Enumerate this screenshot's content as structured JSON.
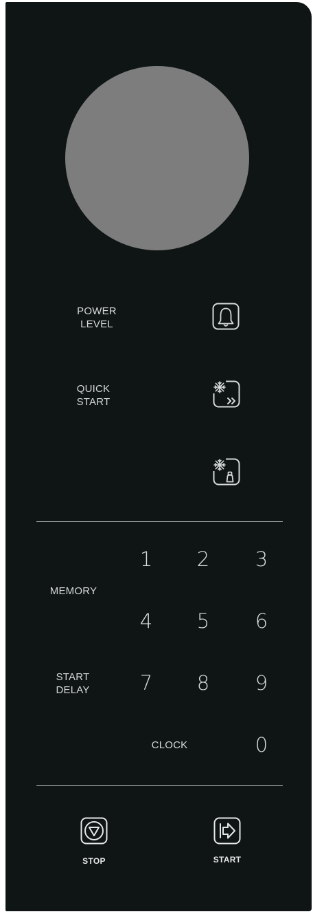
{
  "panel": {
    "power_level_label": "POWER\nLEVEL",
    "quick_start_label": "QUICK\nSTART",
    "memory_label": "MEMORY",
    "start_delay_label": "START\nDELAY",
    "clock_label": "CLOCK",
    "stop_label": "STOP",
    "start_label": "START"
  },
  "keypad": {
    "digits": [
      "1",
      "2",
      "3",
      "4",
      "5",
      "6",
      "7",
      "8",
      "9",
      "0"
    ]
  },
  "icons": {
    "timer": "bell-icon",
    "time_defrost": "snowflake-fast-forward-icon",
    "weight_defrost": "snowflake-weight-icon",
    "stop": "stop-icon",
    "start": "start-arrow-icon"
  },
  "colors": {
    "panel": "#0f1514",
    "display": "#7d7d7d",
    "text": "#d5d9d8",
    "divider": "#a8adac"
  }
}
